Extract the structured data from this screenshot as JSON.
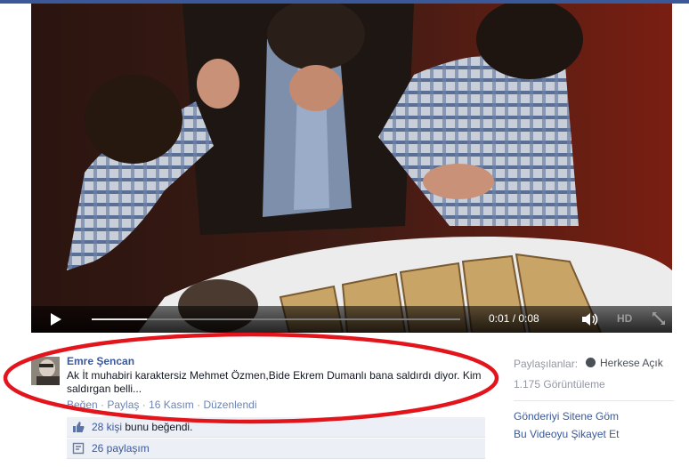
{
  "video": {
    "time": "0:01 / 0:08",
    "hd_label": "HD",
    "progress": 0.15
  },
  "post": {
    "author": "Emre Şencan",
    "message": "Ak İt muhabiri karaktersiz Mehmet Özmen,Bide Ekrem Dumanlı bana saldırdı diyor. Kim saldırgan belli...",
    "actions": {
      "like": "Beğen",
      "share": "Paylaş",
      "date": "16 Kasım",
      "edited": "Düzenlendi",
      "separator": " · "
    }
  },
  "ufi": {
    "likes_link": "28 kişi",
    "likes_rest": "bunu beğendi.",
    "shares": "26 paylaşım"
  },
  "side": {
    "audience_label": "Paylaşılanlar:",
    "audience_value": "Herkese Açık",
    "views": "1.175 Görüntüleme",
    "embed": "Gönderiyi Sitene Göm",
    "report": "Bu Videoyu Şikayet Et"
  },
  "colors": {
    "brand": "#3b5998",
    "annotation": "#e3141b",
    "link": "#3b5998",
    "muted": "#9197a3"
  },
  "icons": [
    "play-icon",
    "volume-icon",
    "fullscreen-icon",
    "globe-icon",
    "like-icon",
    "share-icon"
  ]
}
